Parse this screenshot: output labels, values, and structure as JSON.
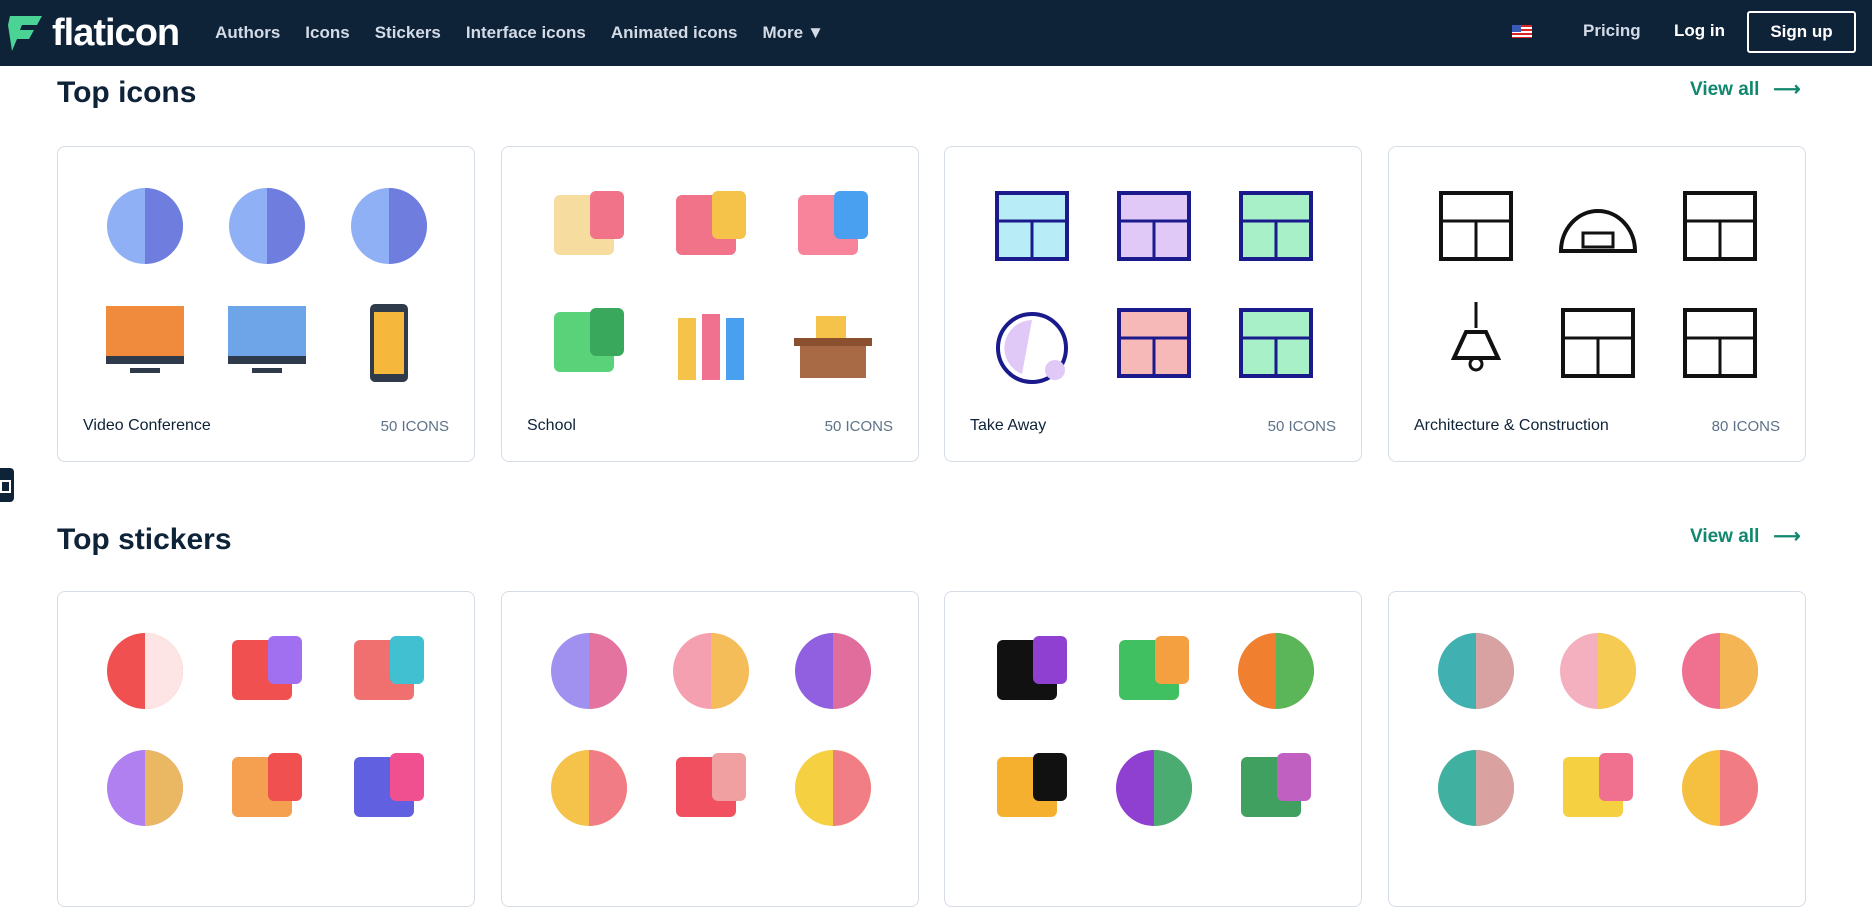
{
  "nav": {
    "logo": "flaticon",
    "links": [
      "Authors",
      "Icons",
      "Stickers",
      "Interface icons",
      "Animated icons",
      "More"
    ],
    "pricing": "Pricing",
    "login": "Log in",
    "signup": "Sign up",
    "language": "us-flag-icon"
  },
  "colors": {
    "nav_bg": "#0e2238",
    "accent": "#12876f",
    "logo_green": "#4ad395"
  },
  "top_icons": {
    "title": "Top icons",
    "view_all": "View all",
    "packs": [
      {
        "label": "Video Conference",
        "count": "50 ICONS",
        "icons": [
          {
            "name": "camera-off-icon",
            "shape": "circle",
            "c1": "#8fb0f5",
            "c2": "#6a74d9"
          },
          {
            "name": "mic-off-icon",
            "shape": "circle",
            "c1": "#8fb0f5",
            "c2": "#6a74d9"
          },
          {
            "name": "voice-message-icon",
            "shape": "circle",
            "c1": "#8fb0f5",
            "c2": "#6a74d9"
          },
          {
            "name": "monitor-grid-icon",
            "shape": "monitor",
            "c1": "#f08a3c",
            "c2": "#2f3b4a"
          },
          {
            "name": "monitor-chat-icon",
            "shape": "monitor",
            "c1": "#6ea4e8",
            "c2": "#2f3b4a"
          },
          {
            "name": "phone-call-icon",
            "shape": "phone",
            "c1": "#f5b73c",
            "c2": "#2f3b4a"
          }
        ]
      },
      {
        "label": "School",
        "count": "50 ICONS",
        "icons": [
          {
            "name": "sticky-notes-icon",
            "shape": "rect",
            "c1": "#f7dca0",
            "c2": "#f0738a"
          },
          {
            "name": "lunch-box-icon",
            "shape": "rect",
            "c1": "#f0738a",
            "c2": "#f5c24a"
          },
          {
            "name": "eraser-icon",
            "shape": "rect",
            "c1": "#f7849a",
            "c2": "#4aa0f0"
          },
          {
            "name": "notebook-icon",
            "shape": "rect",
            "c1": "#5ad27a",
            "c2": "#3aa85c"
          },
          {
            "name": "crayons-icon",
            "shape": "bars",
            "c1": "#f5c24a",
            "c2": "#4aa0f0"
          },
          {
            "name": "desk-icon",
            "shape": "desk",
            "c1": "#a86a44",
            "c2": "#f5c24a"
          }
        ]
      },
      {
        "label": "Take Away",
        "count": "50 ICONS",
        "icons": [
          {
            "name": "takeaway-bag-icon",
            "shape": "outline",
            "c1": "#1a1a8c",
            "c2": "#b8ecf7"
          },
          {
            "name": "food-container-icon",
            "shape": "outline",
            "c1": "#1a1a8c",
            "c2": "#e0c8f7"
          },
          {
            "name": "delivery-truck-icon",
            "shape": "outline",
            "c1": "#1a1a8c",
            "c2": "#a8f0c8"
          },
          {
            "name": "stopwatch-icon",
            "shape": "outline-circle",
            "c1": "#1a1a8c",
            "c2": "#e0c8f7"
          },
          {
            "name": "delivery-man-icon",
            "shape": "outline",
            "c1": "#1a1a8c",
            "c2": "#f7b8b8"
          },
          {
            "name": "scooter-icon",
            "shape": "outline",
            "c1": "#1a1a8c",
            "c2": "#a8f0c8"
          }
        ]
      },
      {
        "label": "Architecture & Construction",
        "count": "80 ICONS",
        "icons": [
          {
            "name": "blueprint-icon",
            "shape": "outline",
            "c1": "#111111",
            "c2": "#ffffff"
          },
          {
            "name": "hangar-icon",
            "shape": "outline-dome",
            "c1": "#111111",
            "c2": "#ffffff"
          },
          {
            "name": "house-icon",
            "shape": "outline",
            "c1": "#111111",
            "c2": "#ffffff"
          },
          {
            "name": "lamp-icon",
            "shape": "outline-lamp",
            "c1": "#111111",
            "c2": "#ffffff"
          },
          {
            "name": "brick-wall-icon",
            "shape": "outline",
            "c1": "#111111",
            "c2": "#ffffff"
          },
          {
            "name": "mail-icon",
            "shape": "outline",
            "c1": "#111111",
            "c2": "#ffffff"
          }
        ]
      }
    ]
  },
  "top_stickers": {
    "title": "Top stickers",
    "view_all": "View all",
    "packs": [
      {
        "icons": [
          {
            "name": "alarm-clock-sticker",
            "shape": "circle",
            "c1": "#f05050",
            "c2": "#ffffff"
          },
          {
            "name": "party-hat-sticker",
            "shape": "rect",
            "c1": "#f05050",
            "c2": "#a070f0"
          },
          {
            "name": "champagne-sticker",
            "shape": "rect",
            "c1": "#f07070",
            "c2": "#40c0d0"
          },
          {
            "name": "enjoy-candy-sticker",
            "shape": "circle",
            "c1": "#b080f0",
            "c2": "#f5c24a"
          },
          {
            "name": "party-cone-sticker",
            "shape": "rect",
            "c1": "#f5a050",
            "c2": "#f05050"
          },
          {
            "name": "firework-rocket-sticker",
            "shape": "rect",
            "c1": "#6060e0",
            "c2": "#f05090"
          }
        ]
      },
      {
        "icons": [
          {
            "name": "mitten-sticker",
            "shape": "circle",
            "c1": "#a090f0",
            "c2": "#f07090"
          },
          {
            "name": "yarn-ball-sticker",
            "shape": "circle",
            "c1": "#f5a0b0",
            "c2": "#f5c24a"
          },
          {
            "name": "heart-knit-sticker",
            "shape": "circle",
            "c1": "#9060e0",
            "c2": "#f07090"
          },
          {
            "name": "girl-sticker",
            "shape": "circle",
            "c1": "#f5c24a",
            "c2": "#f07090"
          },
          {
            "name": "scarf-sticker",
            "shape": "rect",
            "c1": "#f05060",
            "c2": "#f0a0a0"
          },
          {
            "name": "heart-needles-sticker",
            "shape": "circle",
            "c1": "#f5d040",
            "c2": "#f07090"
          }
        ]
      },
      {
        "icons": [
          {
            "name": "bowling-time-sticker",
            "shape": "rect",
            "c1": "#111111",
            "c2": "#9040d0"
          },
          {
            "name": "bowling-pins-sticker",
            "shape": "rect",
            "c1": "#40c060",
            "c2": "#f5a040"
          },
          {
            "name": "bowler-sticker",
            "shape": "circle",
            "c1": "#f08030",
            "c2": "#40c060"
          },
          {
            "name": "strike-sticker",
            "shape": "rect",
            "c1": "#f5b030",
            "c2": "#111111"
          },
          {
            "name": "bowling-team-sticker",
            "shape": "circle",
            "c1": "#9040d0",
            "c2": "#40c060"
          },
          {
            "name": "scoreboard-sticker",
            "shape": "rect",
            "c1": "#40a060",
            "c2": "#c060c0"
          }
        ]
      },
      {
        "icons": [
          {
            "name": "seollal-gift-sticker",
            "shape": "circle",
            "c1": "#40b0b0",
            "c2": "#f5a0a0"
          },
          {
            "name": "bunny-sticker",
            "shape": "circle",
            "c1": "#f5b0c0",
            "c2": "#f5d040"
          },
          {
            "name": "happy-seollal-sticker",
            "shape": "circle",
            "c1": "#f07090",
            "c2": "#f5c24a"
          },
          {
            "name": "kid-bow-sticker",
            "shape": "circle",
            "c1": "#40b0a0",
            "c2": "#f5a0a0"
          },
          {
            "name": "seollal-card-sticker",
            "shape": "rect",
            "c1": "#f5d040",
            "c2": "#f07090"
          },
          {
            "name": "seollal-bag-sticker",
            "shape": "circle",
            "c1": "#f5c040",
            "c2": "#f07090"
          }
        ]
      }
    ]
  }
}
